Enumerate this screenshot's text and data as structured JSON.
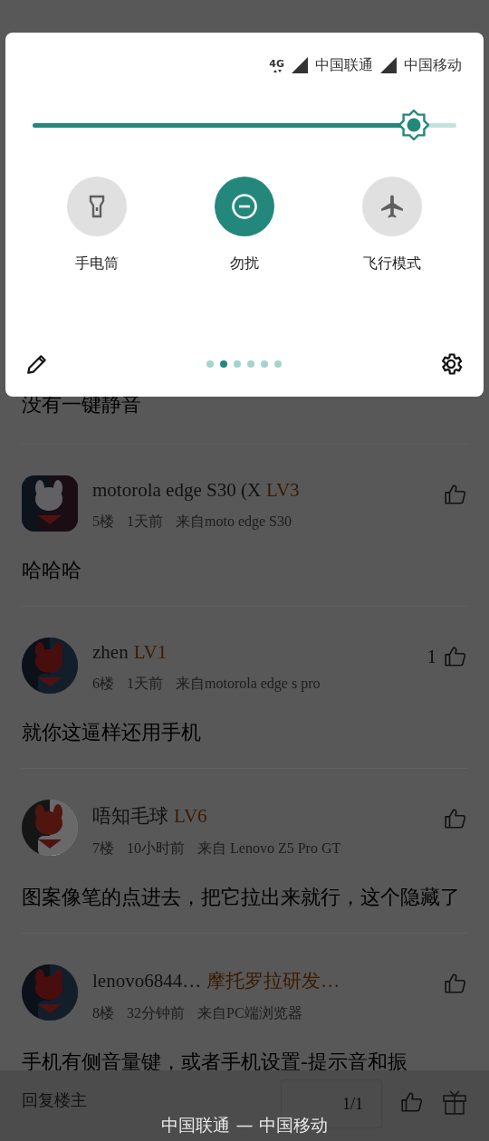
{
  "status": {
    "network": "4G",
    "carriers": [
      "中国联通",
      "中国移动"
    ]
  },
  "brightness": {
    "level": 0.9
  },
  "tiles": [
    {
      "kind": "flashlight",
      "label": "手电筒",
      "on": false
    },
    {
      "kind": "dnd",
      "label": "勿扰",
      "on": true
    },
    {
      "kind": "airplane",
      "label": "飞行模式",
      "on": false
    }
  ],
  "pages": [
    {
      "selected": false
    },
    {
      "selected": true
    },
    {
      "selected": false
    },
    {
      "selected": false
    },
    {
      "selected": false
    },
    {
      "selected": false
    }
  ],
  "previous_body": "没有一键静音",
  "comments": [
    {
      "kind": "square-avatar",
      "name": "motorola edge S30 (X",
      "badge": "LV3",
      "floor": "5楼",
      "time": "1天前",
      "source": "来自moto edge S30",
      "body": "哈哈哈"
    },
    {
      "kind": "round-avatar",
      "name": "zhen",
      "badge": "LV1",
      "likes": "1",
      "floor": "6楼",
      "time": "1天前",
      "source": "来自motorola edge s pro",
      "body": "就你这逼样还用手机"
    },
    {
      "kind": "round-avatar",
      "name": "唔知毛球",
      "badge": "LV6",
      "floor": "7楼",
      "time": "10小时前",
      "source": "来自 Lenovo Z5 Pro GT",
      "body": "图案像笔的点进去，把它拉出来就行，这个隐藏了"
    },
    {
      "kind": "round-avatar",
      "name": "lenovo6844…",
      "badge": "摩托罗拉研发…",
      "floor": "8楼",
      "time": "32分钟前",
      "source": "来自PC端浏览器",
      "body": "手机有侧音量键，或者手机设置-提示音和振"
    }
  ],
  "reply_bar": {
    "placeholder": "回复楼主",
    "page": "1/1"
  },
  "carrier_label": "中国联通 — 中国移动"
}
